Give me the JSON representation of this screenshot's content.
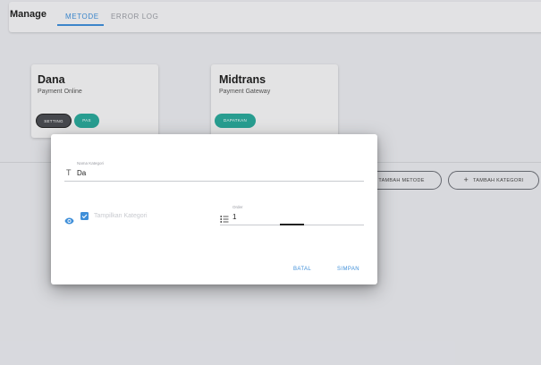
{
  "header": {
    "title": "Manage",
    "tabs": [
      {
        "label": "METODE",
        "active": true
      },
      {
        "label": "ERROR LOG",
        "active": false
      }
    ]
  },
  "cards": [
    {
      "title": "Dana",
      "subtitle": "Payment Online",
      "buttons": [
        "SETTING",
        "PAS"
      ]
    },
    {
      "title": "Midtrans",
      "subtitle": "Payment Gateway",
      "buttons": [
        "DAPATKAN"
      ]
    }
  ],
  "actions": {
    "add_method": "TAMBAH METODE",
    "add_category": "TAMBAH KATEGORI"
  },
  "dialog": {
    "category_name": {
      "label": "Nama Kategori",
      "value": "Da"
    },
    "show_category": {
      "label": "Tampilkan Kategori",
      "checked": true
    },
    "order": {
      "label": "Order",
      "value": "1"
    },
    "cancel_label": "BATAL",
    "save_label": "SIMPAN"
  },
  "icons": {
    "text": "text-icon",
    "eye": "eye-icon",
    "checkbox": "checkbox-checked-icon",
    "order": "ordered-list-icon",
    "plus": "plus-icon"
  },
  "colors": {
    "accent": "#3f8fd9",
    "teal": "#2aa99b",
    "dark_pill": "#4a4c52"
  }
}
